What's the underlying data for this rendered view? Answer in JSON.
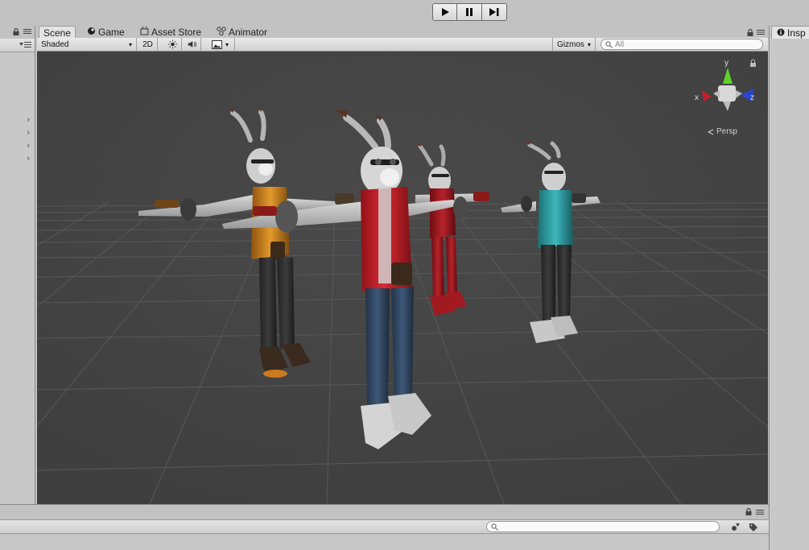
{
  "playbar": {
    "buttons": [
      {
        "name": "play-button",
        "icon": "play-icon"
      },
      {
        "name": "pause-button",
        "icon": "pause-icon"
      },
      {
        "name": "step-button",
        "icon": "step-icon"
      }
    ]
  },
  "tabs": [
    {
      "label": "Scene",
      "icon": "",
      "active": true
    },
    {
      "label": "Game",
      "icon": "game-icon",
      "active": false
    },
    {
      "label": "Asset Store",
      "icon": "asset-store-icon",
      "active": false
    },
    {
      "label": "Animator",
      "icon": "animator-icon",
      "active": false
    }
  ],
  "scene_toolbar": {
    "shading_mode": "Shaded",
    "mode_2d": "2D",
    "gizmos": "Gizmos",
    "search_placeholder": "All"
  },
  "gizmo": {
    "x_label": "x",
    "y_label": "y",
    "z_label": "z",
    "projection": "Persp"
  },
  "inspector": {
    "tab_label": "Insp"
  },
  "colors": {
    "viewport_bg": "#454545",
    "grid_line": "#5a5a5a",
    "axis_x": "#c0202a",
    "axis_y": "#5ed12a",
    "axis_z": "#2a46d1",
    "vest_red": "#c8232b",
    "vest_orange": "#d98a1f",
    "vest_teal": "#2d9fa3",
    "suit_red": "#b01e26"
  },
  "characters": [
    {
      "name": "character-orange-vest"
    },
    {
      "name": "character-red-vest"
    },
    {
      "name": "character-red-suit"
    },
    {
      "name": "character-teal-vest"
    }
  ]
}
